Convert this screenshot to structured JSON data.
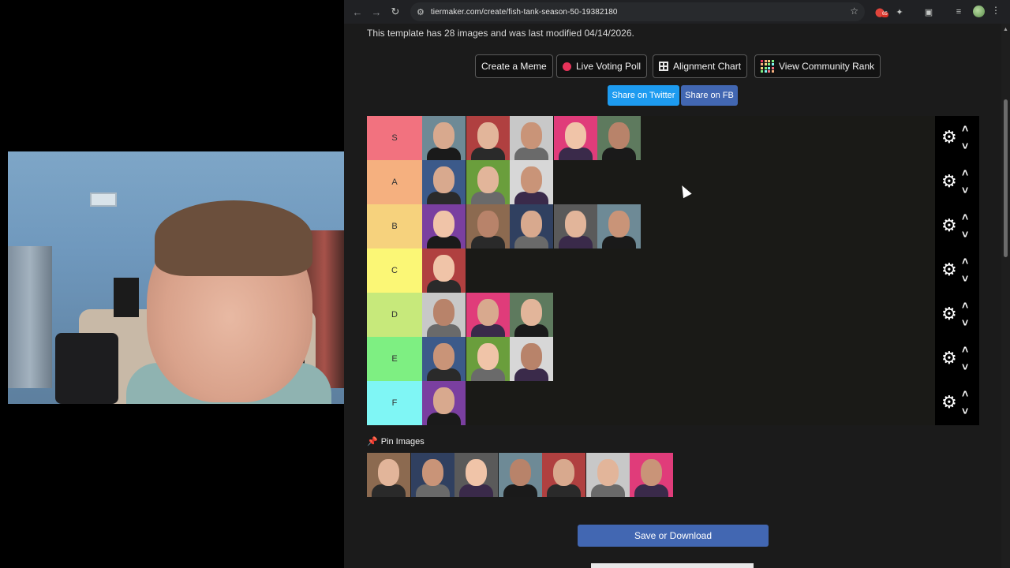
{
  "browser": {
    "url": "tiermaker.com/create/fish-tank-season-50-19382180",
    "ext_badge": "65"
  },
  "info": "This template has 28 images and was last modified 04/14/2026.",
  "buttons": {
    "create_meme": "Create a Meme",
    "live_poll": "Live Voting Poll",
    "alignment": "Alignment Chart",
    "community_rank": "View Community Rank",
    "share_twitter": "Share on Twitter",
    "share_fb": "Share on FB"
  },
  "tiers": [
    {
      "label": "S",
      "color": "#f2727f",
      "count": 5
    },
    {
      "label": "A",
      "color": "#f5b07f",
      "count": 3
    },
    {
      "label": "B",
      "color": "#f6d27d",
      "count": 5
    },
    {
      "label": "C",
      "color": "#fbf776",
      "count": 1
    },
    {
      "label": "D",
      "color": "#c7e97b",
      "count": 3
    },
    {
      "label": "E",
      "color": "#7eef82",
      "count": 3
    },
    {
      "label": "F",
      "color": "#7ff6f5",
      "count": 1
    }
  ],
  "pin_label": "Pin Images",
  "pool_count": 7,
  "save_label": "Save or Download",
  "colors": {
    "twitter": "#1d9bf0",
    "facebook": "#4267b2",
    "accent_red": "#e8335a"
  }
}
